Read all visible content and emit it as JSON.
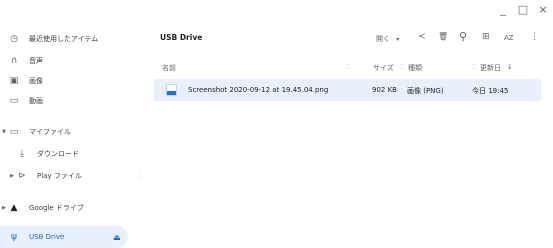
{
  "window": {
    "minimize": "_",
    "maximize": "□",
    "close": "×"
  },
  "sidebar": {
    "items": [
      {
        "label": "最近使用したアイテム",
        "icon": "clock-icon"
      },
      {
        "label": "音声",
        "icon": "headphones-icon"
      },
      {
        "label": "画像",
        "icon": "image-icon"
      },
      {
        "label": "動画",
        "icon": "video-icon"
      },
      {
        "label": "マイファイル",
        "icon": "laptop-icon"
      },
      {
        "label": "ダウンロード",
        "icon": "download-icon"
      },
      {
        "label": "Play ファイル",
        "icon": "play-icon"
      },
      {
        "label": "Google ドライブ",
        "icon": "drive-icon"
      },
      {
        "label": "USB Drive",
        "icon": "usb-icon"
      }
    ]
  },
  "toolbar": {
    "breadcrumb": "USB Drive",
    "open_label": "開く",
    "dropdown": "▾",
    "share": "≺",
    "delete": "🗑",
    "search": "⚲",
    "grid": "⊞",
    "sort": "AZ",
    "more": "⋮"
  },
  "columns": {
    "name": "名前",
    "size": "サイズ",
    "type": "種類",
    "modified": "更新日",
    "sort_arrow": "↓"
  },
  "files": [
    {
      "name": "Screenshot 2020-09-12 at 19.45.04.png",
      "size": "902 KB",
      "type": "画像 (PNG)",
      "modified": "今日 19:45"
    }
  ]
}
